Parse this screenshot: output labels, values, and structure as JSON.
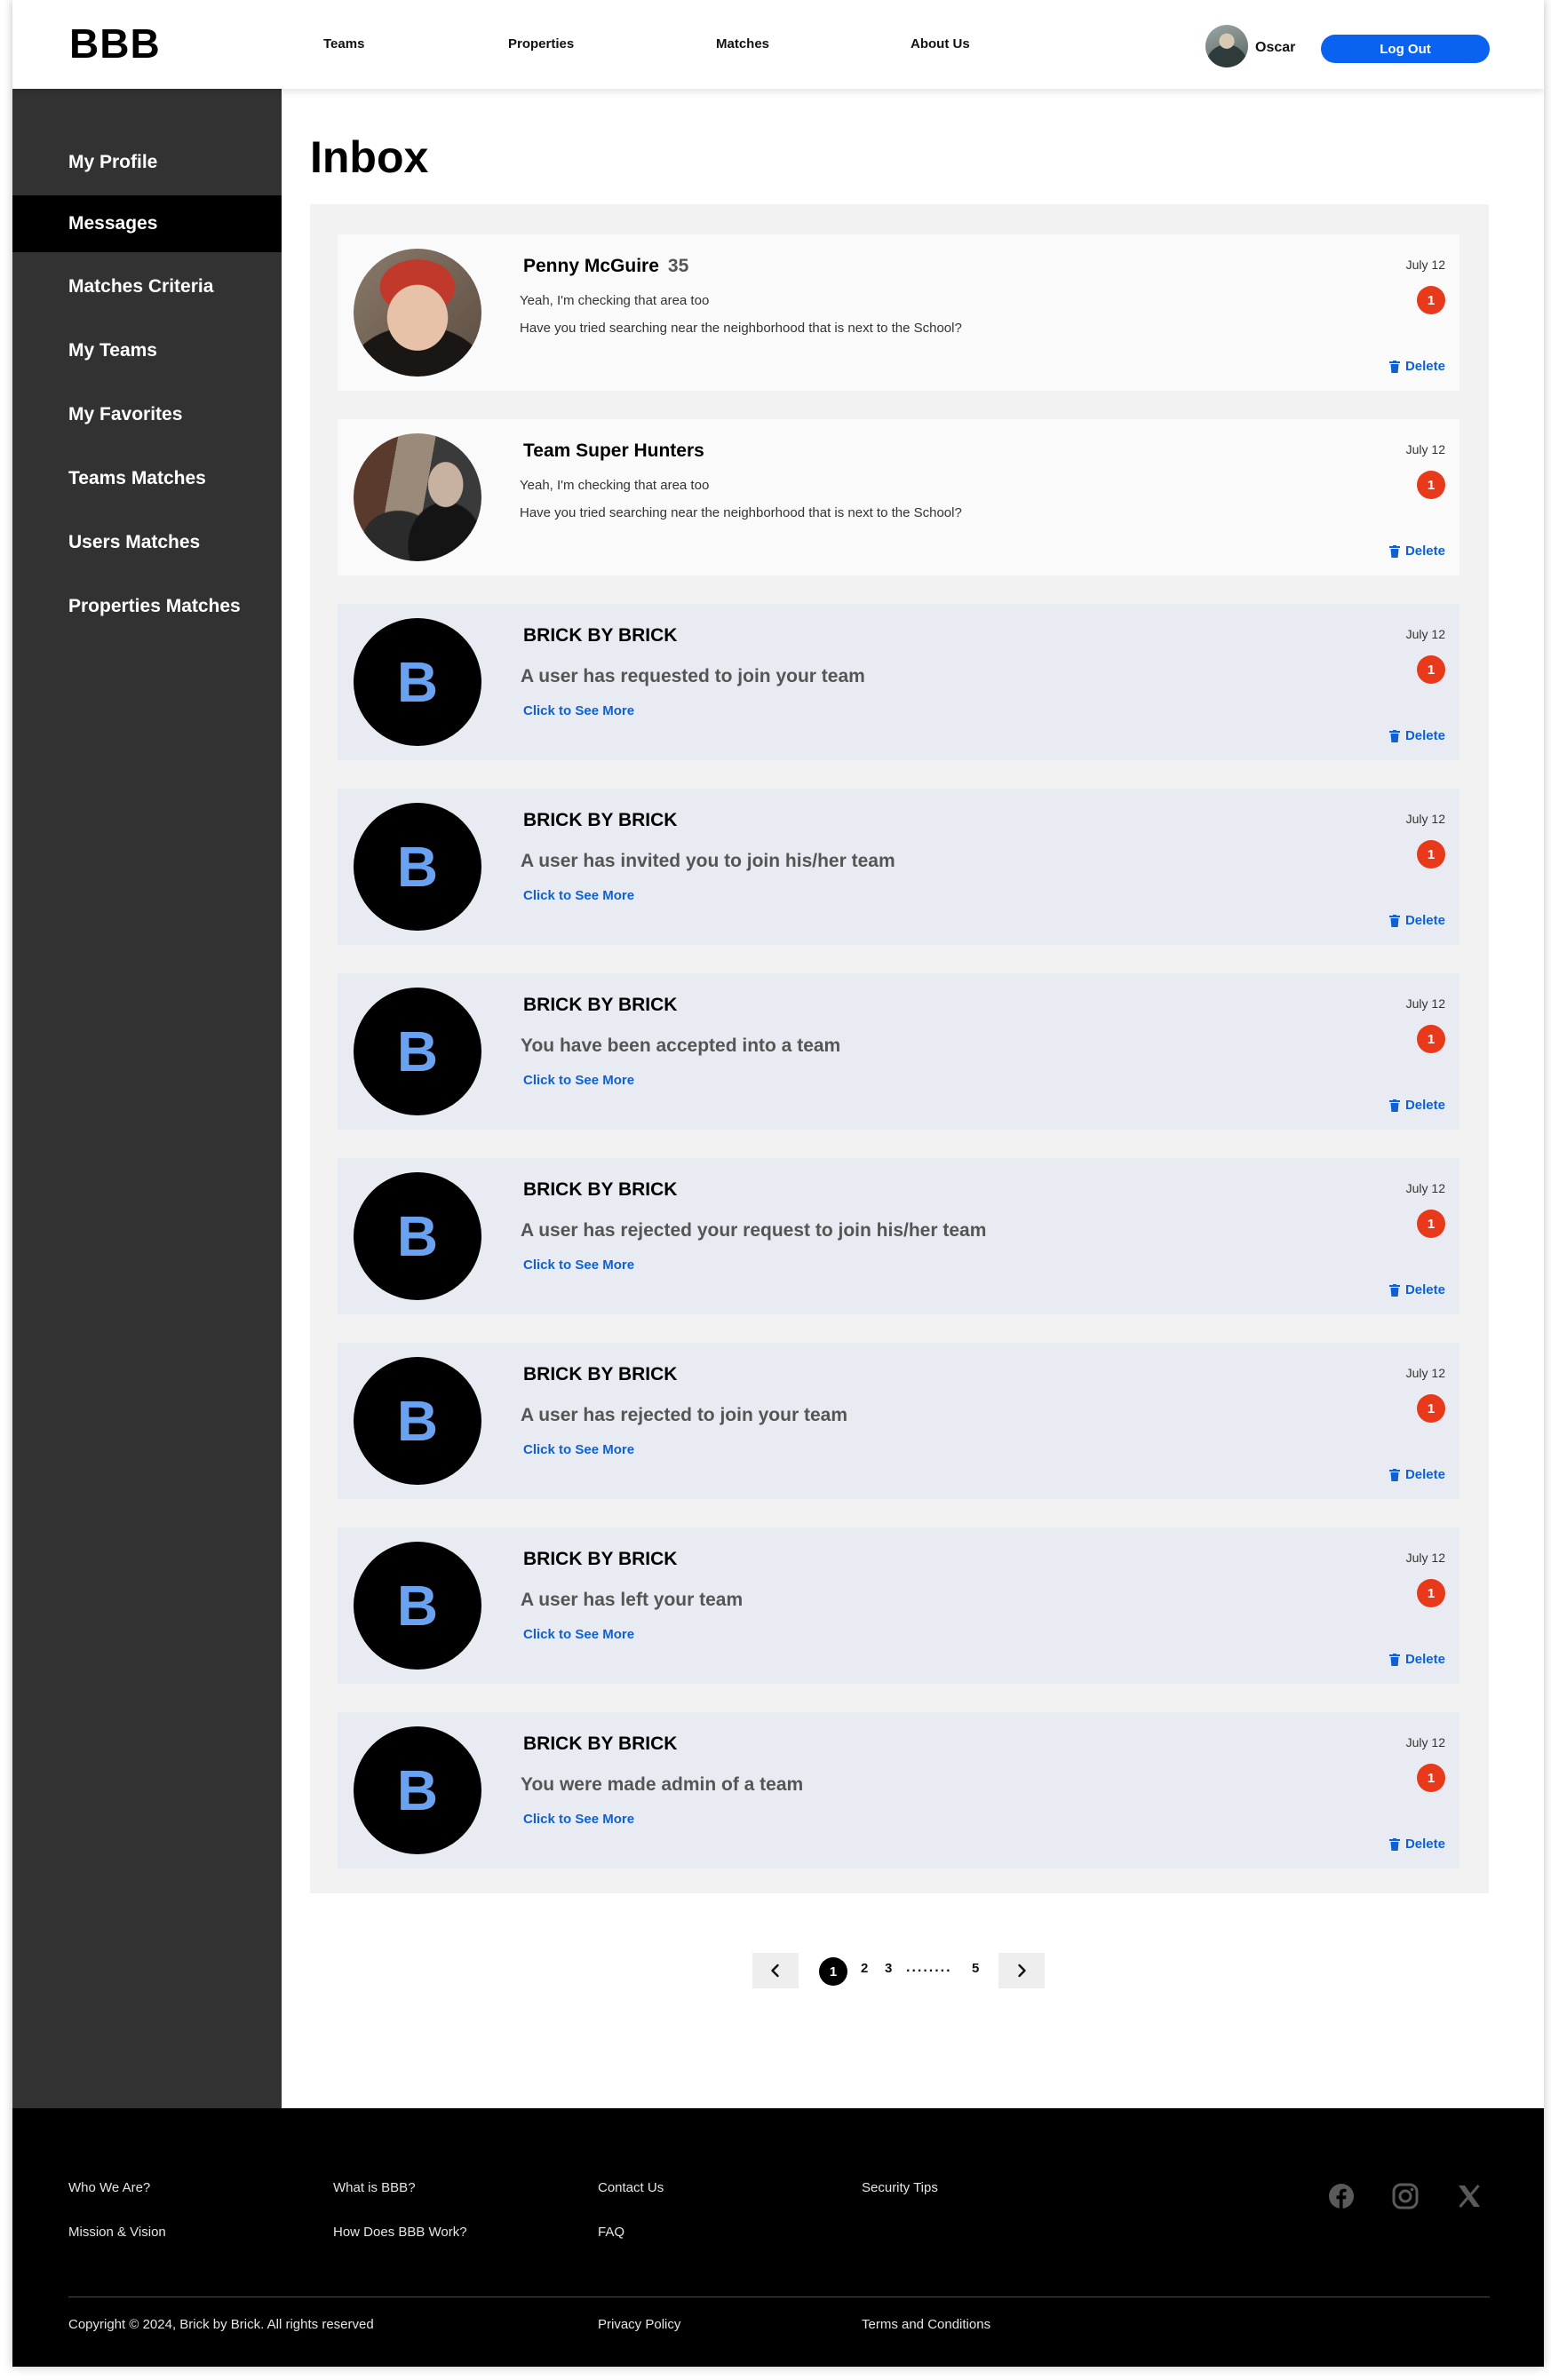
{
  "header": {
    "logo": "BBB",
    "nav": [
      "Teams",
      "Properties",
      "Matches",
      "About Us"
    ],
    "user_name": "Oscar",
    "logout_label": "Log Out"
  },
  "sidebar": {
    "items": [
      {
        "label": "My Profile"
      },
      {
        "label": "Messages",
        "active": true
      },
      {
        "label": "Matches Criteria"
      },
      {
        "label": "My Teams"
      },
      {
        "label": "My Favorites"
      },
      {
        "label": "Teams Matches"
      },
      {
        "label": "Users Matches"
      },
      {
        "label": "Properties Matches"
      }
    ]
  },
  "main": {
    "title": "Inbox",
    "messages": [
      {
        "sender": "Penny McGuire",
        "age": "35",
        "line1": "Yeah, I'm checking that area too",
        "line2": "Have you tried searching near the neighborhood that is next to the School?",
        "date": "July 12",
        "unread": "1",
        "delete_label": "Delete"
      },
      {
        "sender": "Team Super Hunters",
        "line1": "Yeah, I'm checking that area too",
        "line2": "Have you tried searching near the neighborhood that is next to the School?",
        "date": "July 12",
        "unread": "1",
        "delete_label": "Delete"
      },
      {
        "sender": "BRICK BY BRICK",
        "avatar_letter": "B",
        "text": "A user has requested to join your team",
        "link": "Click to See More",
        "date": "July 12",
        "unread": "1",
        "delete_label": "Delete"
      },
      {
        "sender": "BRICK BY BRICK",
        "avatar_letter": "B",
        "text": "A user has invited you to join his/her team",
        "link": "Click to See More",
        "date": "July 12",
        "unread": "1",
        "delete_label": "Delete"
      },
      {
        "sender": "BRICK BY BRICK",
        "avatar_letter": "B",
        "text": "You have been accepted into a team",
        "link": "Click to See More",
        "date": "July 12",
        "unread": "1",
        "delete_label": "Delete"
      },
      {
        "sender": "BRICK BY BRICK",
        "avatar_letter": "B",
        "text": "A user has rejected your request to join his/her team",
        "link": "Click to See More",
        "date": "July 12",
        "unread": "1",
        "delete_label": "Delete"
      },
      {
        "sender": "BRICK BY BRICK",
        "avatar_letter": "B",
        "text": "A user has rejected to join your team",
        "link": "Click to See More",
        "date": "July 12",
        "unread": "1",
        "delete_label": "Delete"
      },
      {
        "sender": "BRICK BY BRICK",
        "avatar_letter": "B",
        "text": "A user has left your team",
        "link": "Click to See More",
        "date": "July 12",
        "unread": "1",
        "delete_label": "Delete"
      },
      {
        "sender": "BRICK BY BRICK",
        "avatar_letter": "B",
        "text": "You were made admin of a team",
        "link": "Click to See More",
        "date": "July 12",
        "unread": "1",
        "delete_label": "Delete"
      }
    ],
    "pagination": {
      "current": "1",
      "pages": [
        "2",
        "3"
      ],
      "dots": "........",
      "last": "5",
      "prev_icon": "chevron-left-icon",
      "next_icon": "chevron-right-icon"
    }
  },
  "footer": {
    "links": [
      "Who We Are?",
      "Mission & Vision",
      "What is BBB?",
      "How Does BBB Work?",
      "Contact Us",
      "FAQ",
      "Security Tips"
    ],
    "copyright": "Copyright © 2024, Brick by Brick. All rights reserved",
    "privacy": "Privacy Policy",
    "terms": "Terms and Conditions",
    "social": [
      "facebook-icon",
      "instagram-icon",
      "x-icon"
    ]
  },
  "colors": {
    "accent": "#0a63f0",
    "badge": "#e8391a",
    "sidebar": "#323232",
    "brand_letter": "#6aa2f2"
  }
}
